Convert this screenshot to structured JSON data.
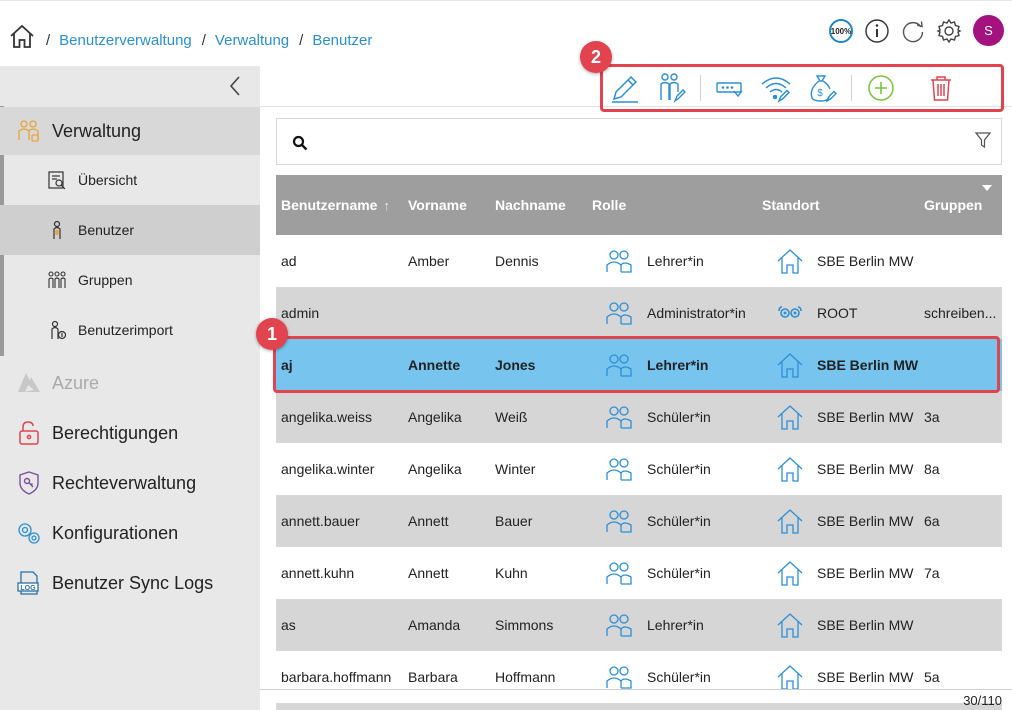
{
  "breadcrumb": {
    "separator": "/",
    "items": [
      "Benutzerverwaltung",
      "Verwaltung",
      "Benutzer"
    ]
  },
  "header": {
    "zoom_label": "100%",
    "avatar_initial": "S",
    "icons": [
      "zoom-100-icon",
      "info-icon",
      "refresh-icon",
      "gear-icon"
    ]
  },
  "sidebar": {
    "items": [
      {
        "label": "Verwaltung",
        "icon": "users-group-icon"
      },
      {
        "label": "Übersicht",
        "icon": "overview-icon"
      },
      {
        "label": "Benutzer",
        "icon": "user-icon"
      },
      {
        "label": "Gruppen",
        "icon": "groups-icon"
      },
      {
        "label": "Benutzerimport",
        "icon": "user-import-icon"
      },
      {
        "label": "Azure",
        "icon": "azure-icon"
      },
      {
        "label": "Berechtigungen",
        "icon": "lock-icon"
      },
      {
        "label": "Rechteverwaltung",
        "icon": "key-shield-icon"
      },
      {
        "label": "Konfigurationen",
        "icon": "gears-icon"
      },
      {
        "label": "Benutzer Sync Logs",
        "icon": "log-icon"
      }
    ]
  },
  "toolbar": {
    "buttons": [
      "edit-icon",
      "user-assign-icon",
      "password-icon",
      "wifi-edit-icon",
      "money-bag-icon",
      "add-icon",
      "delete-icon"
    ]
  },
  "annotations": {
    "badge1": "1",
    "badge2": "2"
  },
  "search": {
    "value": "",
    "placeholder": ""
  },
  "table": {
    "columns": [
      "Benutzername",
      "Vorname",
      "Nachname",
      "Rolle",
      "Standort",
      "Gruppen"
    ],
    "sort_indicator": "↑",
    "rows": [
      {
        "username": "ad",
        "first": "Amber",
        "last": "Dennis",
        "role": "Lehrer*in",
        "location": "SBE Berlin MW",
        "groups": "",
        "location_icon": "house"
      },
      {
        "username": "admin",
        "first": "",
        "last": "",
        "role": "Administrator*in",
        "location": "ROOT",
        "groups": "schreiben...",
        "location_icon": "root"
      },
      {
        "username": "aj",
        "first": "Annette",
        "last": "Jones",
        "role": "Lehrer*in",
        "location": "SBE Berlin MW",
        "groups": "",
        "location_icon": "house"
      },
      {
        "username": "angelika.weiss",
        "first": "Angelika",
        "last": "Weiß",
        "role": "Schüler*in",
        "location": "SBE Berlin MW",
        "groups": "3a",
        "location_icon": "house"
      },
      {
        "username": "angelika.winter",
        "first": "Angelika",
        "last": "Winter",
        "role": "Schüler*in",
        "location": "SBE Berlin MW",
        "groups": "8a",
        "location_icon": "house"
      },
      {
        "username": "annett.bauer",
        "first": "Annett",
        "last": "Bauer",
        "role": "Schüler*in",
        "location": "SBE Berlin MW",
        "groups": "6a",
        "location_icon": "house"
      },
      {
        "username": "annett.kuhn",
        "first": "Annett",
        "last": "Kuhn",
        "role": "Schüler*in",
        "location": "SBE Berlin MW",
        "groups": "7a",
        "location_icon": "house"
      },
      {
        "username": "as",
        "first": "Amanda",
        "last": "Simmons",
        "role": "Lehrer*in",
        "location": "SBE Berlin MW",
        "groups": "",
        "location_icon": "house"
      },
      {
        "username": "barbara.hoffmann",
        "first": "Barbara",
        "last": "Hoffmann",
        "role": "Schüler*in",
        "location": "SBE Berlin MW",
        "groups": "5a",
        "location_icon": "house"
      }
    ],
    "selected_index": 2
  },
  "pager": {
    "text": "30/110"
  },
  "colors": {
    "accent": "#2b8fd6",
    "selected_row": "#77c5ef",
    "highlight": "#e2444f",
    "header_bg": "#9e9e9e",
    "avatar": "#a3127f"
  }
}
